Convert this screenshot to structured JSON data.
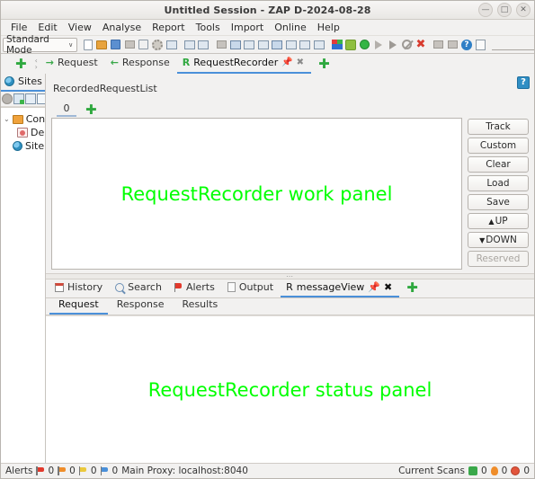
{
  "window": {
    "title": "Untitled Session - ZAP D-2024-08-28",
    "buttons": {
      "minimize": "—",
      "maximize": "□",
      "close": "✕"
    }
  },
  "menubar": {
    "items": [
      "File",
      "Edit",
      "View",
      "Analyse",
      "Report",
      "Tools",
      "Import",
      "Online",
      "Help"
    ]
  },
  "toolbar": {
    "mode": "Standard Mode",
    "caret": "∨",
    "icons": [
      "new-session-icon",
      "open-session-icon",
      "save-session-icon",
      "snapshot-icon",
      "session-properties-icon",
      "options-icon",
      "manage-addons-icon",
      "expand-layout-icon",
      "contract-layout-icon",
      "full-layout-icon",
      "layout-full-icon",
      "layout-split-icon",
      "layout-tabs-icon",
      "layout-cols-icon",
      "layout-rows-icon",
      "layout-three-icon",
      "layout-bottom-icon",
      "scan-policy-icon",
      "spider-icon",
      "active-scan-icon",
      "resume-icon",
      "play-icon",
      "stop-icon",
      "close-all-icon",
      "record-icon",
      "screenshot-icon",
      "help-icon",
      "panel-icon"
    ]
  },
  "top_tabs": {
    "add_left_label": "✚",
    "scroll_glyph": "‹ ›",
    "add_right_label": "✚",
    "items": [
      {
        "label": "Request",
        "icon": "arrow-right-icon",
        "glyph": "→",
        "active": false,
        "pinned": false
      },
      {
        "label": "Response",
        "icon": "arrow-left-icon",
        "glyph": "←",
        "active": false,
        "pinned": false
      },
      {
        "label": "RequestRecorder",
        "icon": "recorder-r-icon",
        "glyph": "R",
        "active": true,
        "pinned": true,
        "pin": "📌",
        "close": "✖"
      }
    ]
  },
  "sidebar": {
    "tab": {
      "label": "Sites",
      "icon": "globe-icon"
    },
    "tools": [
      "ball-icon",
      "new-window-icon",
      "window-icon",
      "window-alt-icon"
    ],
    "tree": [
      {
        "label": "Cont",
        "icon": "folder-icon",
        "arrow": "⌄",
        "indent": 0
      },
      {
        "label": "De",
        "icon": "default-context-icon",
        "indent": 1
      },
      {
        "label": "Site",
        "icon": "globe-icon",
        "indent": 1
      }
    ]
  },
  "work_area": {
    "help_badge": "?",
    "list_label": "RecordedRequestList",
    "count": "0",
    "add_label": "✚",
    "panel_text": "RequestRecorder work panel",
    "panel_text_color": "#00ff00",
    "buttons": [
      {
        "label": "Track",
        "disabled": false
      },
      {
        "label": "Custom",
        "disabled": false
      },
      {
        "label": "Clear",
        "disabled": false
      },
      {
        "label": "Load",
        "disabled": false
      },
      {
        "label": "Save",
        "disabled": false
      },
      {
        "label": "UP",
        "glyph": "▲",
        "disabled": false
      },
      {
        "label": "DOWN",
        "glyph": "▼",
        "disabled": false
      },
      {
        "label": "Reserved",
        "disabled": true
      }
    ]
  },
  "splitter": {
    "grip": "⋯"
  },
  "bottom": {
    "tabs": [
      {
        "label": "History",
        "icon": "history-icon",
        "active": false
      },
      {
        "label": "Search",
        "icon": "search-icon",
        "active": false
      },
      {
        "label": "Alerts",
        "icon": "alert-flag-icon",
        "active": false
      },
      {
        "label": "Output",
        "icon": "output-icon",
        "active": false
      },
      {
        "label": "messageView",
        "icon": "recorder-r-icon",
        "glyph": "R",
        "active": true,
        "pinned": true,
        "pin": "📌",
        "close": "✖"
      }
    ],
    "add_label": "✚",
    "sub_tabs": [
      {
        "label": "Request",
        "active": true
      },
      {
        "label": "Response",
        "active": false
      },
      {
        "label": "Results",
        "active": false
      }
    ],
    "panel_text": "RequestRecorder status panel",
    "panel_text_color": "#00ff00"
  },
  "statusbar": {
    "alerts_label": "Alerts",
    "alert_counts": [
      {
        "level": "high",
        "color": "red",
        "count": "0"
      },
      {
        "level": "medium",
        "color": "orange",
        "count": "0"
      },
      {
        "level": "low",
        "color": "yellow",
        "count": "0"
      },
      {
        "level": "info",
        "color": "blue",
        "count": "0"
      }
    ],
    "proxy_label": "Main Proxy: localhost:8040",
    "scans_label": "Current Scans",
    "scan_counts": [
      {
        "type": "spider",
        "count": "0"
      },
      {
        "type": "flame",
        "count": "0"
      },
      {
        "type": "circle",
        "count": "0"
      }
    ]
  }
}
